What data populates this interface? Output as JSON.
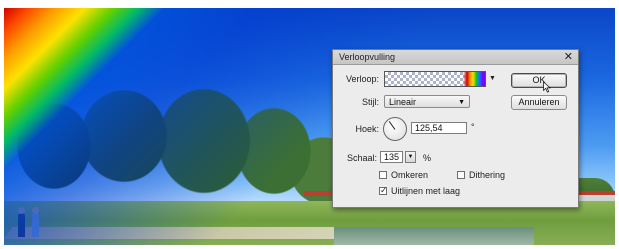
{
  "dialog": {
    "title": "Verloopvulling",
    "close_glyph": "✕",
    "gradient_label": "Verloop:",
    "style_label": "Stijl:",
    "style_value": "Lineair",
    "angle_label": "Hoek:",
    "angle_value": "125,54",
    "angle_unit": "°",
    "scale_label": "Schaal:",
    "scale_value": "135",
    "scale_unit": "%",
    "reverse_label": "Omkeren",
    "reverse_checked": false,
    "dither_label": "Dithering",
    "dither_checked": false,
    "align_label": "Uitlijnen met laag",
    "align_checked": true,
    "ok_label": "OK",
    "cancel_label": "Annuleren"
  },
  "icons": {
    "close": "close-icon",
    "dropdown": "chevron-down-icon",
    "angle": "angle-dial-icon",
    "cursor": "mouse-pointer-icon"
  }
}
